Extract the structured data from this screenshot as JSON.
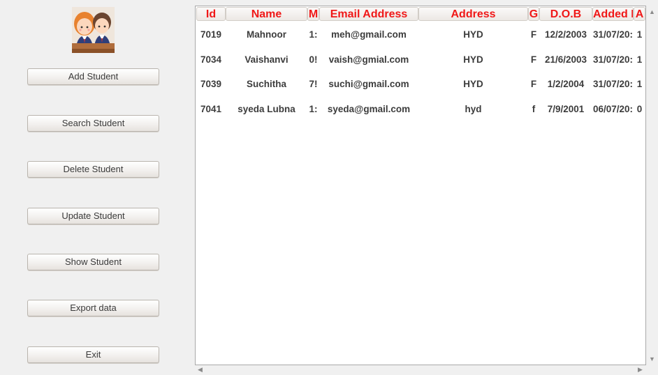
{
  "sidebar": {
    "logo_icon": "students-avatar-icon",
    "buttons": [
      {
        "label": "Add Student"
      },
      {
        "label": "Search Student"
      },
      {
        "label": "Delete Student"
      },
      {
        "label": "Update Student"
      },
      {
        "label": "Show Student"
      },
      {
        "label": "Export data"
      },
      {
        "label": "Exit"
      }
    ]
  },
  "table": {
    "header_color": "#f01818",
    "columns": [
      "Id",
      "Name",
      "M",
      "Email Address",
      "Address",
      "G",
      "D.O.B",
      "Added I",
      "A"
    ],
    "rows": [
      {
        "id": "7019",
        "name": "Mahnoor",
        "mobile": "1:",
        "email": "meh@gmail.com",
        "address": "HYD",
        "gender": "F",
        "dob": "12/2/2003",
        "added": "31/07/20:",
        "extra": "1"
      },
      {
        "id": "7034",
        "name": "Vaishanvi",
        "mobile": "0!",
        "email": "vaish@gmial.com",
        "address": "HYD",
        "gender": "F",
        "dob": "21/6/2003",
        "added": "31/07/20:",
        "extra": "1"
      },
      {
        "id": "7039",
        "name": "Suchitha",
        "mobile": "7!",
        "email": "suchi@gmail.com",
        "address": "HYD",
        "gender": "F",
        "dob": "1/2/2004",
        "added": "31/07/20:",
        "extra": "1"
      },
      {
        "id": "7041",
        "name": "syeda Lubna",
        "mobile": "1:",
        "email": "syeda@gmail.com",
        "address": "hyd",
        "gender": "f",
        "dob": "7/9/2001",
        "added": "06/07/20:",
        "extra": "0"
      }
    ]
  },
  "scrollbars": {
    "up_arrow_icon": "scroll-up-arrow-icon",
    "down_arrow_icon": "scroll-down-arrow-icon",
    "left_arrow_icon": "scroll-left-arrow-icon",
    "right_arrow_icon": "scroll-right-arrow-icon"
  }
}
